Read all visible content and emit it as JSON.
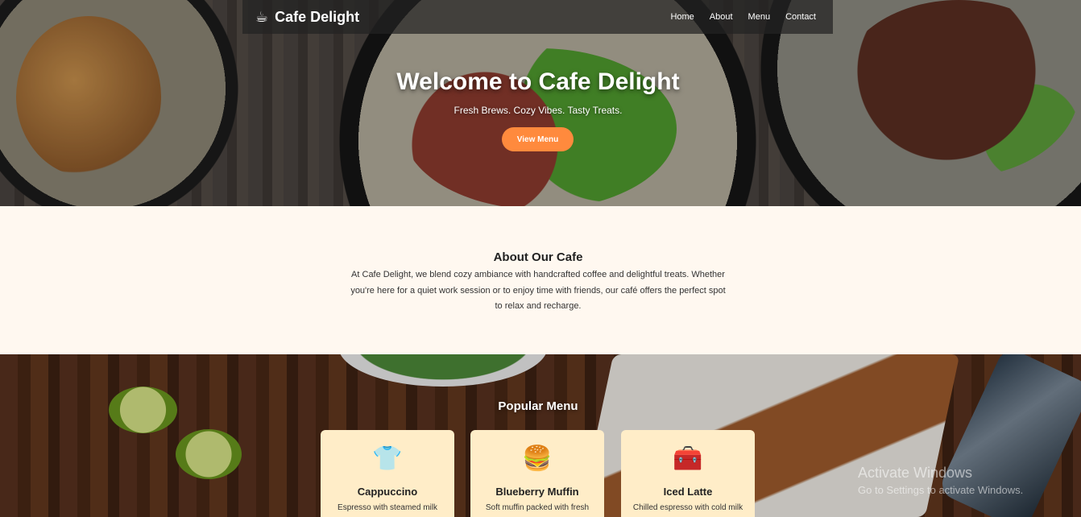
{
  "brand": {
    "icon": "coffee-cup-icon",
    "glyph": "☕",
    "name": "Cafe Delight"
  },
  "nav": {
    "items": [
      {
        "label": "Home"
      },
      {
        "label": "About"
      },
      {
        "label": "Menu"
      },
      {
        "label": "Contact"
      }
    ]
  },
  "hero": {
    "title": "Welcome to Cafe Delight",
    "subtitle": "Fresh Brews. Cozy Vibes. Tasty Treats.",
    "button_label": "View Menu"
  },
  "about": {
    "title": "About Our Cafe",
    "text": "At Cafe Delight, we blend cozy ambiance with handcrafted coffee and delightful treats. Whether you're here for a quiet work session or to enjoy time with friends, our café offers the perfect spot to relax and recharge."
  },
  "menu": {
    "title": "Popular Menu",
    "items": [
      {
        "icon": "tshirt-icon",
        "glyph": "👕",
        "name": "Cappuccino",
        "description": "Espresso with steamed milk"
      },
      {
        "icon": "burger-icon",
        "glyph": "🍔",
        "name": "Blueberry Muffin",
        "description": "Soft muffin packed with fresh"
      },
      {
        "icon": "treasure-chest-icon",
        "glyph": "🧰",
        "name": "Iced Latte",
        "description": "Chilled espresso with cold milk"
      }
    ]
  },
  "watermark": {
    "line1": "Activate Windows",
    "line2": "Go to Settings to activate Windows."
  },
  "colors": {
    "accent": "#ff8a3d",
    "card_bg": "#ffedc8",
    "page_bg": "#fff8f0",
    "navbar_bg": "#232323"
  }
}
